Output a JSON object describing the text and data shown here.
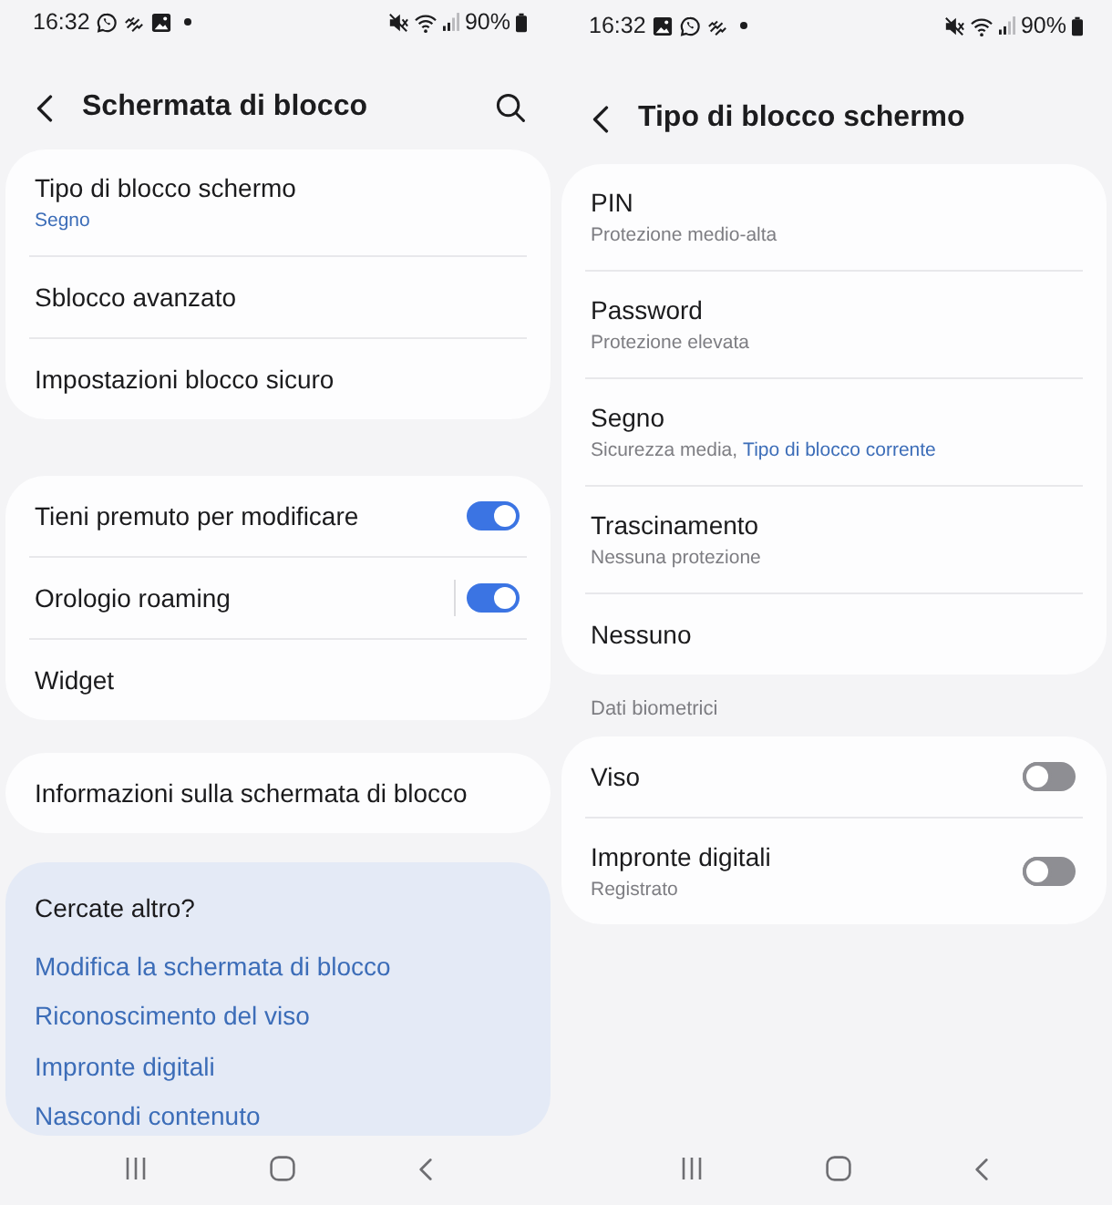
{
  "screens": [
    {
      "status_bar": {
        "time": "16:32",
        "battery": "90%"
      },
      "header": {
        "title": "Schermata di blocco",
        "search": true
      },
      "groups": [
        {
          "items": [
            {
              "kind": "nav",
              "label": "Tipo di blocco schermo",
              "value": "Segno"
            },
            {
              "kind": "nav",
              "label": "Sblocco avanzato"
            },
            {
              "kind": "nav",
              "label": "Impostazioni blocco sicuro"
            }
          ]
        },
        {
          "items": [
            {
              "kind": "switch",
              "label": "Tieni premuto per modificare",
              "on": true
            },
            {
              "kind": "split-switch",
              "label": "Orologio roaming",
              "on": true
            },
            {
              "kind": "nav",
              "label": "Widget"
            }
          ]
        },
        {
          "items": [
            {
              "kind": "nav",
              "label": "Informazioni sulla schermata di blocco"
            }
          ]
        }
      ],
      "suggestions": {
        "title": "Cercate altro?",
        "links": [
          "Modifica la schermata di blocco",
          "Riconoscimento del viso",
          "Impronte digitali",
          "Nascondi contenuto"
        ]
      }
    },
    {
      "status_bar": {
        "time": "16:32",
        "battery": "90%"
      },
      "header": {
        "title": "Tipo di blocco schermo",
        "search": false
      },
      "groups": [
        {
          "items": [
            {
              "kind": "nav",
              "label": "PIN",
              "subtitle": "Protezione medio-alta"
            },
            {
              "kind": "nav",
              "label": "Password",
              "subtitle": "Protezione elevata"
            },
            {
              "kind": "nav",
              "label": "Segno",
              "subtitle": "Sicurezza media,",
              "value": "Tipo di blocco corrente"
            },
            {
              "kind": "nav",
              "label": "Trascinamento",
              "subtitle": "Nessuna protezione"
            },
            {
              "kind": "nav",
              "label": "Nessuno"
            }
          ]
        },
        {
          "title": "Dati biometrici",
          "items": [
            {
              "kind": "switch",
              "label": "Viso",
              "on": false
            },
            {
              "kind": "switch",
              "label": "Impronte digitali",
              "subtitle": "Registrato",
              "on": false
            }
          ]
        }
      ]
    }
  ]
}
